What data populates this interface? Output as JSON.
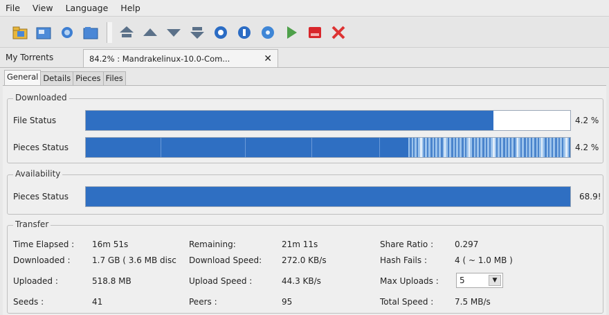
{
  "menu": [
    "File",
    "View",
    "Language",
    "Help"
  ],
  "toolbar": {
    "icons": [
      "open-file-icon",
      "open-url-icon",
      "open-folder-icon",
      "new-torrent-icon",
      "move-top-icon",
      "move-up-icon",
      "move-down-icon",
      "move-bottom-icon",
      "refresh-icon",
      "info-icon",
      "settings-icon",
      "start-icon",
      "stop-icon",
      "remove-icon"
    ]
  },
  "torrent_tabs": {
    "first": "My Torrents",
    "active": "84.2% : Mandrakelinux-10.0-Com...",
    "close": "✕"
  },
  "detail_tabs": [
    "General",
    "Details",
    "Pieces",
    "Files"
  ],
  "downloaded": {
    "title": "Downloaded",
    "file_status": {
      "label": "File Status",
      "fill": 0.842,
      "pct": "4.2 %"
    },
    "pieces_status": {
      "label": "Pieces Status",
      "pct": "4.2 %"
    }
  },
  "availability": {
    "title": "Availability",
    "pieces_status": {
      "label": "Pieces Status",
      "fill": 1.0,
      "pct": "68.9!"
    }
  },
  "transfer": {
    "title": "Transfer",
    "time_elapsed_label": "Time Elapsed :",
    "time_elapsed": "16m 51s",
    "remaining_label": "Remaining:",
    "remaining": "21m 11s",
    "share_ratio_label": "Share Ratio :",
    "share_ratio": "0.297",
    "downloaded_label": "Downloaded :",
    "downloaded": "1.7 GB ( 3.6 MB disc",
    "download_speed_label": "Download Speed:",
    "download_speed": "272.0 KB/s",
    "hash_fails_label": "Hash Fails :",
    "hash_fails": "4 ( ~ 1.0 MB )",
    "uploaded_label": "Uploaded :",
    "uploaded": "518.8 MB",
    "upload_speed_label": "Upload Speed :",
    "upload_speed": "44.3 KB/s",
    "max_uploads_label": "Max Uploads :",
    "max_uploads": "5",
    "seeds_label": "Seeds :",
    "seeds": "41",
    "peers_label": "Peers :",
    "peers": "95",
    "total_speed_label": "Total Speed :",
    "total_speed": "7.5 MB/s"
  },
  "colors": {
    "bar": "#2f6fc2",
    "bar_light": "#9cc3ec"
  }
}
